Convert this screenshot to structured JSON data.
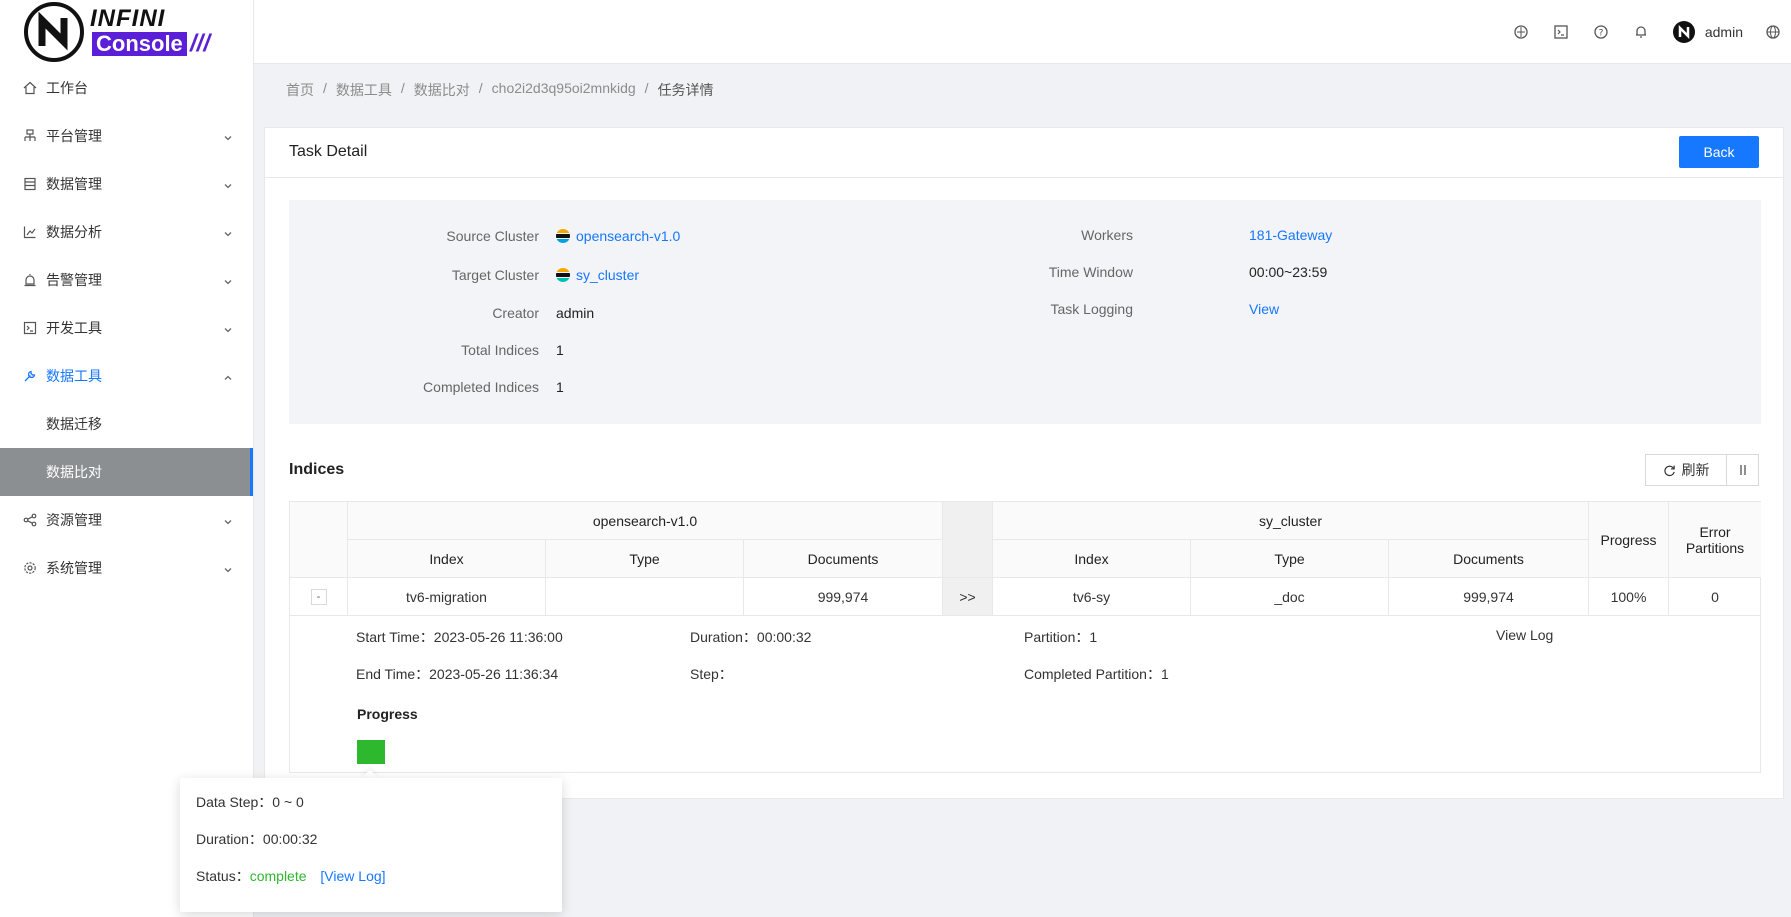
{
  "app": {
    "logo_top": "INFINI",
    "logo_bottom": "Console",
    "logo_slashes": "///"
  },
  "header": {
    "username": "admin",
    "icons": [
      "cloud-icon",
      "terminal-icon",
      "help-icon",
      "bell-icon",
      "globe-icon"
    ]
  },
  "sidebar": {
    "items": [
      {
        "label": "工作台",
        "icon": "home-icon"
      },
      {
        "label": "平台管理",
        "icon": "cluster-icon"
      },
      {
        "label": "数据管理",
        "icon": "database-icon"
      },
      {
        "label": "数据分析",
        "icon": "chart-icon"
      },
      {
        "label": "告警管理",
        "icon": "alarm-icon"
      },
      {
        "label": "开发工具",
        "icon": "code-icon"
      },
      {
        "label": "数据工具",
        "icon": "tool-icon"
      },
      {
        "label": "资源管理",
        "icon": "share-icon"
      },
      {
        "label": "系统管理",
        "icon": "settings-icon"
      }
    ],
    "subitems": [
      {
        "label": "数据迁移"
      },
      {
        "label": "数据比对"
      }
    ]
  },
  "breadcrumb": [
    "首页",
    "数据工具",
    "数据比对",
    "cho2i2d3q95oi2mnkidg",
    "任务详情"
  ],
  "card": {
    "title": "Task Detail",
    "back_label": "Back"
  },
  "info": {
    "source_cluster_label": "Source Cluster",
    "source_cluster_value": "opensearch-v1.0",
    "target_cluster_label": "Target Cluster",
    "target_cluster_value": "sy_cluster",
    "creator_label": "Creator",
    "creator_value": "admin",
    "total_indices_label": "Total Indices",
    "total_indices_value": "1",
    "completed_indices_label": "Completed Indices",
    "completed_indices_value": "1",
    "workers_label": "Workers",
    "workers_value": "181-Gateway",
    "time_window_label": "Time Window",
    "time_window_value": "00:00~23:59",
    "task_logging_label": "Task Logging",
    "task_logging_value": "View"
  },
  "indices": {
    "title": "Indices",
    "refresh_label": "刷新",
    "source_group": "opensearch-v1.0",
    "target_group": "sy_cluster",
    "col_index": "Index",
    "col_type": "Type",
    "col_documents": "Documents",
    "col_progress": "Progress",
    "col_error_partitions_1": "Error",
    "col_error_partitions_2": "Partitions",
    "row": {
      "expand": "-",
      "source_index": "tv6-migration",
      "source_type": "",
      "source_documents": "999,974",
      "arrow": ">>",
      "target_index": "tv6-sy",
      "target_type": "_doc",
      "target_documents": "999,974",
      "progress": "100%",
      "error_partitions": "0"
    },
    "detail": {
      "start_time_label": "Start Time：",
      "start_time_value": "2023-05-26 11:36:00",
      "duration_label": "Duration：",
      "duration_value": "00:00:32",
      "partition_label": "Partition：",
      "partition_value": "1",
      "view_log": "View Log",
      "end_time_label": "End Time：",
      "end_time_value": "2023-05-26 11:36:34",
      "step_label": "Step：",
      "step_value": "",
      "completed_partition_label": "Completed Partition：",
      "completed_partition_value": "1",
      "progress_title": "Progress"
    }
  },
  "tooltip": {
    "data_step_label": "Data Step：",
    "data_step_value": "0 ~ 0",
    "duration_label": "Duration：",
    "duration_value": "00:00:32",
    "status_label": "Status：",
    "status_value": "complete",
    "view_log": "[View Log]"
  },
  "colors": {
    "primary": "#1677ff",
    "success": "#2eb82e",
    "brand": "#5a1fd6"
  }
}
